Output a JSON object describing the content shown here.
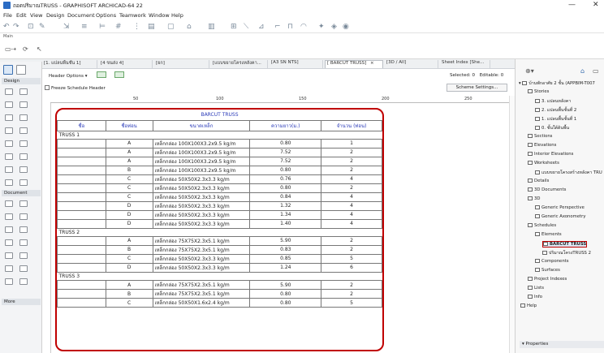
{
  "window": {
    "title": "ถอดปริมาณTRUSS - GRAPHISOFT ARCHICAD-64 22",
    "minimize": "—",
    "close": "✕"
  },
  "menu": [
    "File",
    "Edit",
    "View",
    "Design",
    "Document",
    "Options",
    "Teamwork",
    "Window",
    "Help"
  ],
  "toolbar_label": "Main",
  "tabs": [
    {
      "label": "[1. แปลนพื้นชั้น 1]"
    },
    {
      "label": "[4 ขนส่ง 4]"
    },
    {
      "label": "[ยก]"
    },
    {
      "label": "[แบบขยายโครงหลังคา..."
    },
    {
      "label": "[A3 SN NTS]"
    },
    {
      "label": "[ BARCUT TRUSS]",
      "close": "×"
    },
    {
      "label": "[3D / All]"
    },
    {
      "label": "Sheet Index [She..."
    }
  ],
  "left_panel": {
    "sections": [
      "Design",
      "Document",
      "More"
    ]
  },
  "options": {
    "header_options": "Header Options",
    "selected_label": "Selected:",
    "selected_value": "0",
    "editable_label": "Editable:",
    "editable_value": "0",
    "freeze_label": "Freeze Schedule Header",
    "scheme_button": "Scheme Settings..."
  },
  "ruler": [
    "50",
    "100",
    "150",
    "200",
    "250"
  ],
  "schedule": {
    "title": "BARCUT TRUSS",
    "headers": [
      "ชื่อ",
      "ชื่อท่อน",
      "ขนาดเหล็ก",
      "ความยาว(ม.)",
      "จำนวน (ท่อน)"
    ],
    "groups": [
      {
        "name": "TRUSS 1",
        "rows": [
          [
            "A",
            "เหล็กกล่อง 100X100X3.2x9.5 kg/m",
            "0.80",
            "1"
          ],
          [
            "A",
            "เหล็กกล่อง 100X100X3.2x9.5 kg/m",
            "7.52",
            "2"
          ],
          [
            "A",
            "เหล็กกล่อง 100X100X3.2x9.5 kg/m",
            "7.52",
            "2"
          ],
          [
            "B",
            "เหล็กกล่อง 100X100X3.2x9.5 kg/m",
            "0.80",
            "2"
          ],
          [
            "C",
            "เหล็กกล่อง 50X50X2.3x3.3 kg/m",
            "0.76",
            "4"
          ],
          [
            "C",
            "เหล็กกล่อง 50X50X2.3x3.3 kg/m",
            "0.80",
            "2"
          ],
          [
            "C",
            "เหล็กกล่อง 50X50X2.3x3.3 kg/m",
            "0.84",
            "4"
          ],
          [
            "D",
            "เหล็กกล่อง 50X50X2.3x3.3 kg/m",
            "1.32",
            "4"
          ],
          [
            "D",
            "เหล็กกล่อง 50X50X2.3x3.3 kg/m",
            "1.34",
            "4"
          ],
          [
            "D",
            "เหล็กกล่อง 50X50X2.3x3.3 kg/m",
            "1.40",
            "4"
          ]
        ]
      },
      {
        "name": "TRUSS 2",
        "rows": [
          [
            "A",
            "เหล็กกล่อง 75X75X2.3x5.1 kg/m",
            "5.90",
            "2"
          ],
          [
            "B",
            "เหล็กกล่อง 75X75X2.3x5.1 kg/m",
            "0.83",
            "2"
          ],
          [
            "C",
            "เหล็กกล่อง 50X50X2.3x3.3 kg/m",
            "0.85",
            "5"
          ],
          [
            "D",
            "เหล็กกล่อง 50X50X2.3x3.3 kg/m",
            "1.24",
            "6"
          ]
        ]
      },
      {
        "name": "TRUSS 3",
        "rows": [
          [
            "A",
            "เหล็กกล่อง 75X75X2.3x5.1 kg/m",
            "5.90",
            "2"
          ],
          [
            "B",
            "เหล็กกล่อง 75X75X2.3x5.1 kg/m",
            "0.80",
            "2"
          ],
          [
            "C",
            "เหล็กกล่อง 50X50X1.6x2.4 kg/m",
            "0.80",
            "5"
          ]
        ]
      }
    ]
  },
  "navigator": {
    "root": "บ้านพักอาศัย 2 ชั้น (APPBIM-T007",
    "items": [
      {
        "label": "Stories",
        "indent": 1
      },
      {
        "label": "3. แปลนหลังคา",
        "indent": 2
      },
      {
        "label": "2. แปลนพื้นชั้นที่ 2",
        "indent": 2
      },
      {
        "label": "1. แปลนพื้นชั้นที่ 1",
        "indent": 2
      },
      {
        "label": "0. ชั้นใต้ดินพื้น",
        "indent": 2
      },
      {
        "label": "Sections",
        "indent": 1
      },
      {
        "label": "Elevations",
        "indent": 1
      },
      {
        "label": "Interior Elevations",
        "indent": 1
      },
      {
        "label": "Worksheets",
        "indent": 1
      },
      {
        "label": "แบบขยายโครงสร้างหลังคา TRU",
        "indent": 2
      },
      {
        "label": "Details",
        "indent": 1
      },
      {
        "label": "3D Documents",
        "indent": 1
      },
      {
        "label": "3D",
        "indent": 1
      },
      {
        "label": "Generic Perspective",
        "indent": 2
      },
      {
        "label": "Generic Axonometry",
        "indent": 2
      },
      {
        "label": "Schedules",
        "indent": 1
      },
      {
        "label": "Elements",
        "indent": 2
      },
      {
        "label": "BARCUT TRUSS",
        "indent": 3,
        "active": true
      },
      {
        "label": "ปริมาณโครงTRUSS 2",
        "indent": 3
      },
      {
        "label": "Components",
        "indent": 2
      },
      {
        "label": "Surfaces",
        "indent": 2
      },
      {
        "label": "Project Indexes",
        "indent": 1
      },
      {
        "label": "Lists",
        "indent": 1
      },
      {
        "label": "Info",
        "indent": 1
      },
      {
        "label": "Help",
        "indent": 0
      }
    ],
    "properties": "Properties"
  },
  "colors": {
    "highlight": "#c00000",
    "header_text": "#2a3ab8",
    "accent": "#2b6cc4"
  }
}
